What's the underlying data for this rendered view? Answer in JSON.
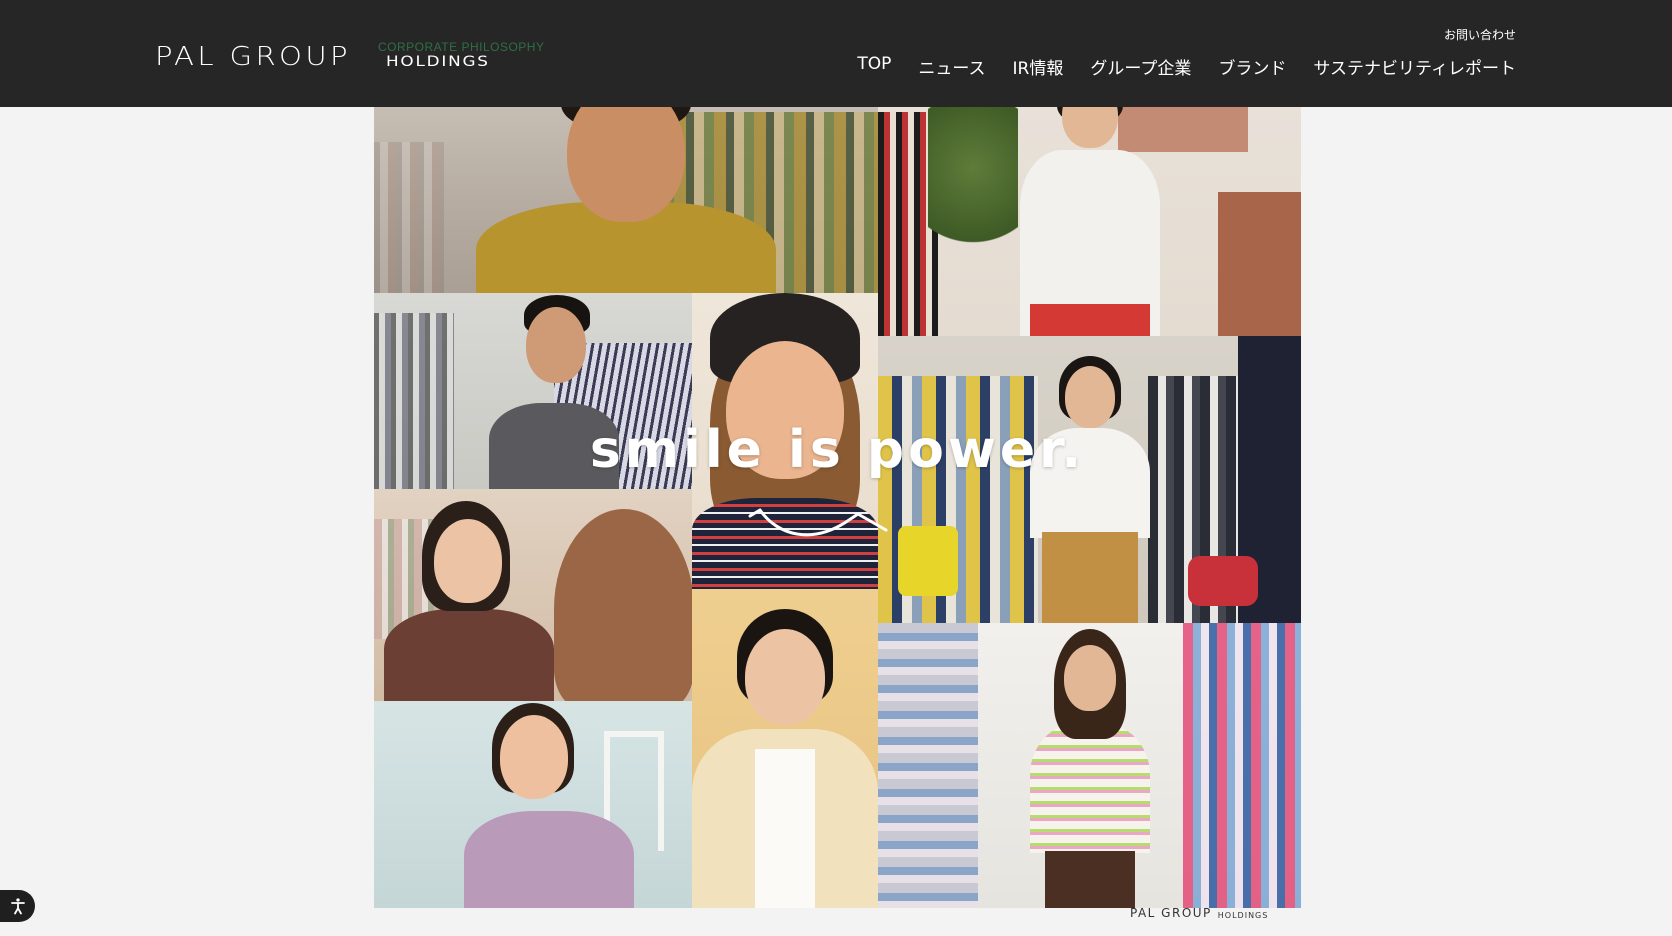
{
  "header": {
    "logo_main": "PAL GROUP",
    "logo_sub": "HOLDINGS",
    "section_label": "CORPORATE PHILOSOPHY",
    "contact_label": "お問い合わせ",
    "nav": [
      {
        "label": "TOP"
      },
      {
        "label": "ニュース"
      },
      {
        "label": "IR情報"
      },
      {
        "label": "グループ企業"
      },
      {
        "label": "ブランド"
      },
      {
        "label": "サステナビリティレポート"
      }
    ]
  },
  "hero": {
    "tagline": "smile is power."
  },
  "footer_logo": {
    "main": "PAL GROUP",
    "sub": "HOLDINGS"
  },
  "accessibility": {
    "icon": "accessibility-icon"
  },
  "colors": {
    "header_bg": "#262626",
    "page_bg": "#f3f3f3",
    "section_label": "#2f6f45",
    "nav_text": "#ffffff"
  }
}
